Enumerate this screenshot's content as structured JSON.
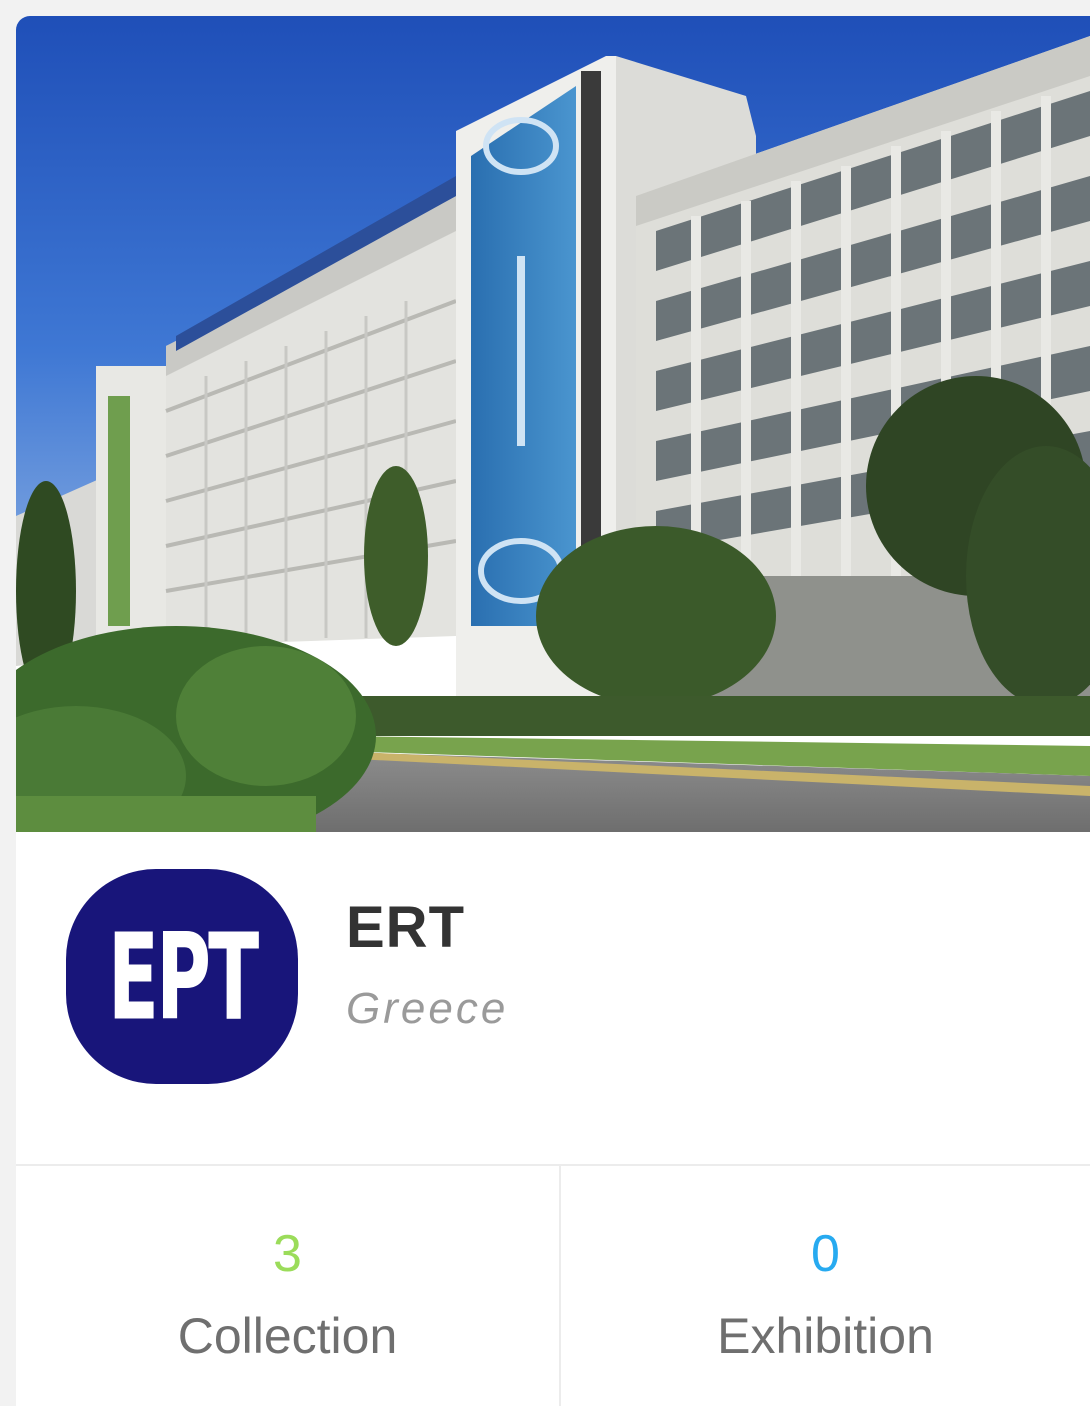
{
  "organization": {
    "name": "ERT",
    "country": "Greece",
    "logo_text": "EPT",
    "logo_color": "#18157a",
    "cover_image_icon": "building-photo"
  },
  "stats": {
    "collection": {
      "value": "3",
      "label": "Collection",
      "color": "#9bdc5a"
    },
    "exhibition": {
      "value": "0",
      "label": "Exhibition",
      "color": "#27aaf0"
    }
  }
}
